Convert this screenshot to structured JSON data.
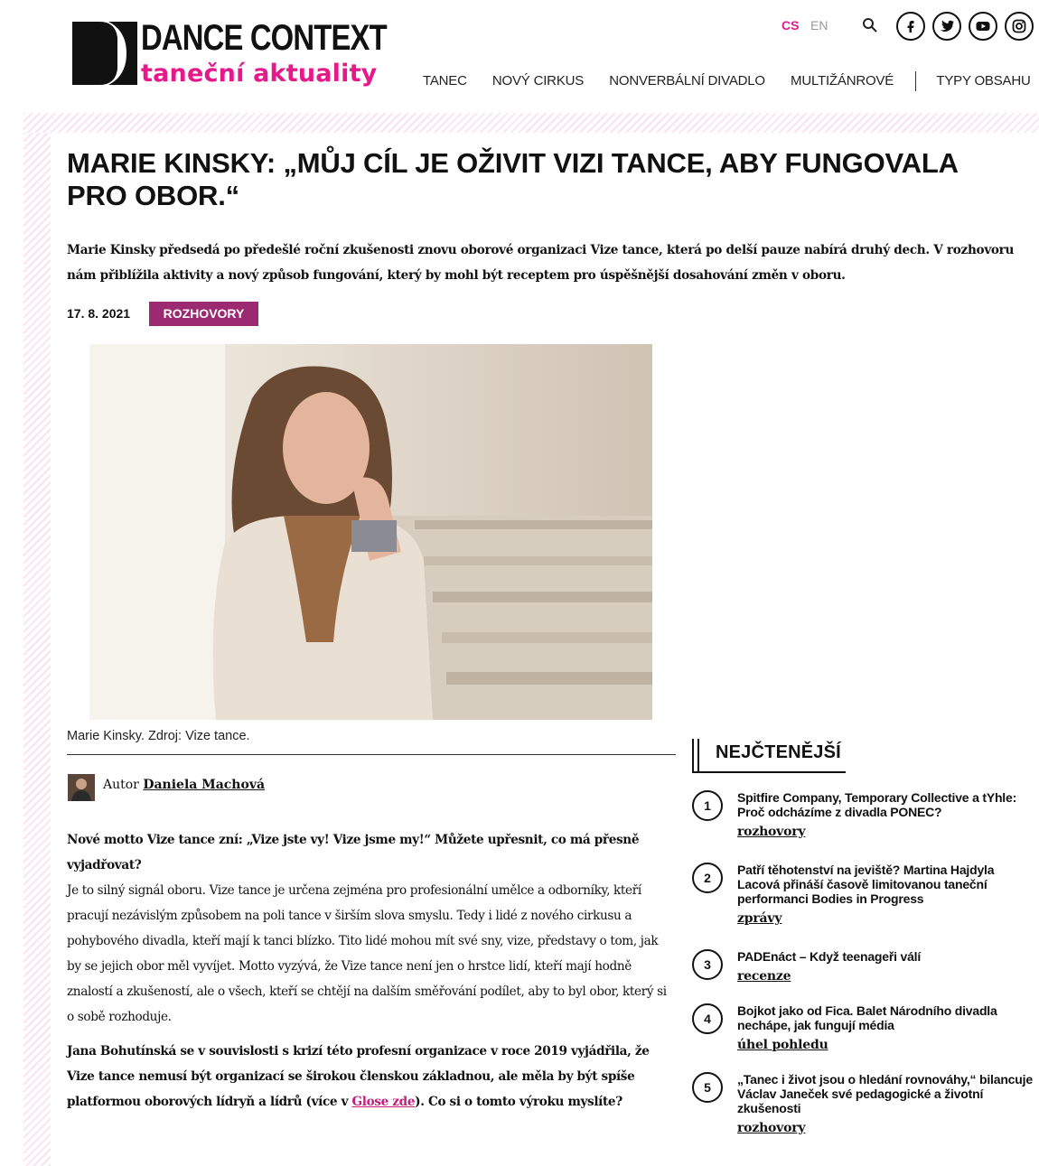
{
  "header": {
    "logo": {
      "title": "DANCE CONTEXT",
      "subtitle": "taneční aktuality"
    },
    "lang": {
      "cs": "CS",
      "en": "EN"
    },
    "nav": [
      "TANEC",
      "NOVÝ CIRKUS",
      "NONVERBÁLNÍ DIVADLO",
      "MULTIŽÁNROVÉ",
      "TYPY OBSAHU"
    ],
    "icons": [
      "search-icon",
      "facebook-icon",
      "twitter-icon",
      "youtube-icon",
      "instagram-icon"
    ]
  },
  "article": {
    "title": "MARIE KINSKY: „MŮJ CÍL JE OŽIVIT VIZI TANCE, ABY FUNGOVALA PRO OBOR.“",
    "perex": "Marie Kinsky předsedá po předešlé roční zkušenosti znovu oborové organizaci Vize tance, která po delší pauze nabírá druhý dech. V rozhovoru nám přiblížila aktivity a nový způsob fungování, který by mohl být receptem pro úspěšnější dosahování změn v oboru.",
    "date": "17. 8. 2021",
    "category": "ROZHOVORY",
    "caption": "Marie Kinsky. Zdroj: Vize tance.",
    "author_prefix": "Autor",
    "author_name": "Daniela Machová",
    "q1": "Nové motto Vize tance zní: „Vize jste vy! Vize jsme my!“ Můžete upřesnit, co má přesně vyjadřovat?",
    "a1": "Je to silný signál oboru. Vize tance je určena zejména pro profesionální umělce a odborníky, kteří pracují nezávislým způsobem na poli tance v širším slova smyslu. Tedy i lidé z nového cirkusu a pohybového divadla, kteří mají k tanci blízko. Tito lidé mohou mít své sny, vize, představy o tom, jak by se jejich obor měl vyvíjet. Motto vyzývá, že Vize tance není jen o hrstce lidí, kteří mají hodně znalostí a zkušeností, ale o všech, kteří se chtějí na dalším směřování podílet, aby to byl obor, který si o sobě rozhoduje.",
    "q2_a": "Jana Bohutínská se v souvislosti s krizí této profesní organizace v roce 2019 vyjádřila, že Vize tance nemusí být organizací se širokou členskou základnou, ale měla by být spíše platformou oborových lídryň a lídrů (více v ",
    "q2_link": "Glose zde",
    "q2_b": "). Co si o tomto výroku myslíte?"
  },
  "sidebar": {
    "title": "NEJČTENĚJŠÍ",
    "items": [
      {
        "num": "1",
        "title": "Spitfire Company, Temporary Collective a tYhle: Proč odcházíme z divadla PONEC?",
        "category": "rozhovory"
      },
      {
        "num": "2",
        "title": "Patří těhotenství na jeviště? Martina Hajdyla Lacová přináší časově limitovanou taneční performanci Bodies in Progress",
        "category": "zprávy"
      },
      {
        "num": "3",
        "title": "PADEnáct – Když teenageři válí",
        "category": "recenze"
      },
      {
        "num": "4",
        "title": "Bojkot jako od Fica. Balet Národního divadla nechápe, jak fungují média",
        "category": "úhel pohledu"
      },
      {
        "num": "5",
        "title": "„Tanec i život jsou o hledání rovnováhy,“ bilancuje Václav Janeček své pedagogické a životní zkušenosti",
        "category": "rozhovory"
      }
    ]
  },
  "colors": {
    "accent": "#e6198a",
    "tag": "#9b2a71"
  }
}
